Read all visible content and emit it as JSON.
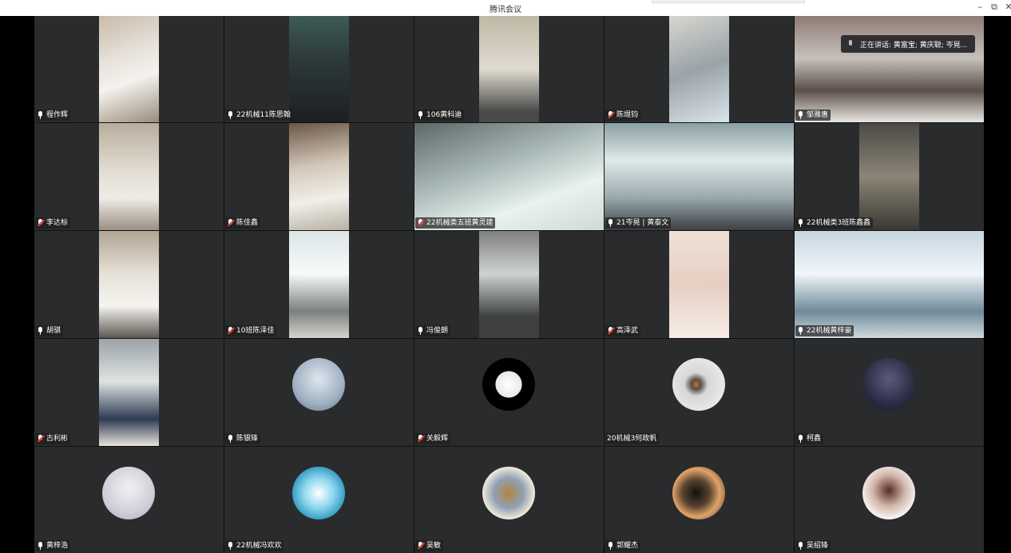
{
  "window": {
    "title": "腾讯会议",
    "minimize_glyph": "–",
    "restore_glyph": "⧉",
    "close_glyph": "✕"
  },
  "speaking_indicator": {
    "text": "正在讲话: 黄富宝; 黄庆聪; 岑晃..."
  },
  "participants": [
    {
      "name": "程作辉",
      "mic": "on"
    },
    {
      "name": "22机械11陈思翰",
      "mic": "on"
    },
    {
      "name": "106黄科迪",
      "mic": "on"
    },
    {
      "name": "陈焜钧",
      "mic": "off"
    },
    {
      "name": "邹雅惠",
      "mic": "on"
    },
    {
      "name": "李达标",
      "mic": "off"
    },
    {
      "name": "陈佳鑫",
      "mic": "off"
    },
    {
      "name": "22机械类五班黄灵建",
      "mic": "off"
    },
    {
      "name": "21岑晃 | 黄泰文",
      "mic": "on"
    },
    {
      "name": "22机械类3班陈鑫鑫",
      "mic": "on"
    },
    {
      "name": "胡骐",
      "mic": "on"
    },
    {
      "name": "10班陈泽佳",
      "mic": "off"
    },
    {
      "name": "冯俊朗",
      "mic": "on"
    },
    {
      "name": "高泽武",
      "mic": "off"
    },
    {
      "name": "22机械黄梓豪",
      "mic": "on"
    },
    {
      "name": "古利彬",
      "mic": "off"
    },
    {
      "name": "陈银锋",
      "mic": "on"
    },
    {
      "name": "关毅辉",
      "mic": "off"
    },
    {
      "name": "20机械3何政帆",
      "mic": "none"
    },
    {
      "name": "柯鑫",
      "mic": "on"
    },
    {
      "name": "黄梓浩",
      "mic": "on"
    },
    {
      "name": "22机械冯欢欢",
      "mic": "on"
    },
    {
      "name": "吴敏",
      "mic": "off"
    },
    {
      "name": "郭耀杰",
      "mic": "on"
    },
    {
      "name": "吴绍锋",
      "mic": "on"
    }
  ]
}
